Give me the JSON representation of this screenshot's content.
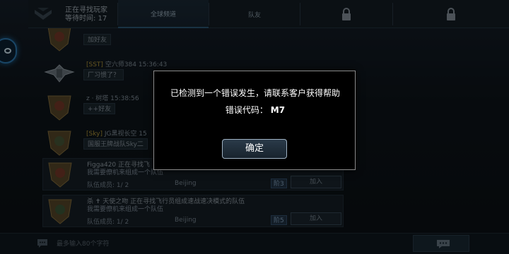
{
  "topbar": {
    "status_line1": "正在寻找玩家",
    "status_line2": "等待时间: 17",
    "tabs": [
      "全球频道",
      "队友"
    ],
    "locked_tabs": 2
  },
  "chat": {
    "messages": [
      {
        "name": "",
        "text": "加好友"
      },
      {
        "tag": "[SST]",
        "name": " 空六师384 15:36:43",
        "text": "厂习惯了？"
      },
      {
        "tag": "",
        "name": "z · 树塔 15:38:56",
        "text": "++好友"
      },
      {
        "tag": "[Sky]",
        "name": " JG黑视长空  15",
        "text": "国服王牌战队Sky二"
      }
    ],
    "teams": [
      {
        "title": "Figga420 正在寻找飞",
        "subtitle": "我需要僚机来组成一个队伍",
        "members": "队伍成员: 1/ 2",
        "location": "Beijing",
        "rank": "阶3",
        "join": "加入"
      },
      {
        "title": "杀 ✝ 天使之吻 正在寻找飞行员组成速战速决模式的队伍",
        "subtitle": "我需要僚机来组成一个队伍",
        "members": "队伍成员: 1/ 2",
        "location": "Beijing",
        "rank": "阶5",
        "join": "加入"
      }
    ]
  },
  "bottombar": {
    "input_placeholder": "最多输入80个字符"
  },
  "dialog": {
    "message": "已检测到一个错误发生，请联系客户获得帮助",
    "code_label": "错误代码：",
    "code_value": "M7",
    "ok_label": "确定"
  },
  "colors": {
    "accent": "#2f7fb8",
    "clan_tag": "#b59a3a",
    "dialog_bg": "#000000"
  },
  "icons": [
    "rank-chevron-icon",
    "lock-icon",
    "chat-bubble-icon",
    "send-message-icon",
    "eye-icon",
    "military-badge-icon",
    "wings-badge-icon"
  ]
}
